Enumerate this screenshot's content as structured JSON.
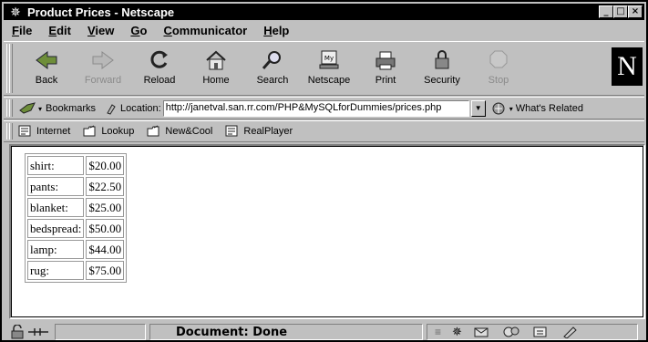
{
  "window": {
    "title": "Product Prices - Netscape",
    "controls": [
      "_",
      "□",
      "×"
    ]
  },
  "menu": [
    {
      "label": "File",
      "key": "F",
      "rest": "ile"
    },
    {
      "label": "Edit",
      "key": "E",
      "rest": "dit"
    },
    {
      "label": "View",
      "key": "V",
      "rest": "iew"
    },
    {
      "label": "Go",
      "key": "G",
      "rest": "o"
    },
    {
      "label": "Communicator",
      "key": "C",
      "rest": "ommunicator"
    },
    {
      "label": "Help",
      "key": "H",
      "rest": "elp"
    }
  ],
  "navbar": [
    {
      "label": "Back",
      "icon": "back-icon",
      "enabled": true
    },
    {
      "label": "Forward",
      "icon": "forward-icon",
      "enabled": false
    },
    {
      "label": "Reload",
      "icon": "reload-icon",
      "enabled": true
    },
    {
      "label": "Home",
      "icon": "home-icon",
      "enabled": true
    },
    {
      "label": "Search",
      "icon": "search-icon",
      "enabled": true
    },
    {
      "label": "Netscape",
      "icon": "my-netscape-icon",
      "enabled": true
    },
    {
      "label": "Print",
      "icon": "print-icon",
      "enabled": true
    },
    {
      "label": "Security",
      "icon": "security-icon",
      "enabled": true
    },
    {
      "label": "Stop",
      "icon": "stop-icon",
      "enabled": false
    }
  ],
  "logo": "N",
  "location": {
    "bookmarks_label": "Bookmarks",
    "location_label": "Location:",
    "url": "http://janetval.san.rr.com/PHP&MySQLforDummies/prices.php",
    "whats_related": "What's Related"
  },
  "personal": [
    {
      "label": "Internet",
      "icon": "page-icon"
    },
    {
      "label": "Lookup",
      "icon": "folder-icon"
    },
    {
      "label": "New&Cool",
      "icon": "folder-icon"
    },
    {
      "label": "RealPlayer",
      "icon": "page-icon"
    }
  ],
  "prices": [
    {
      "item": "shirt:",
      "price": "$20.00"
    },
    {
      "item": "pants:",
      "price": "$22.50"
    },
    {
      "item": "blanket:",
      "price": "$25.00"
    },
    {
      "item": "bedspread:",
      "price": "$50.00"
    },
    {
      "item": "lamp:",
      "price": "$44.00"
    },
    {
      "item": "rug:",
      "price": "$75.00"
    }
  ],
  "status": {
    "text": "Document: Done"
  }
}
